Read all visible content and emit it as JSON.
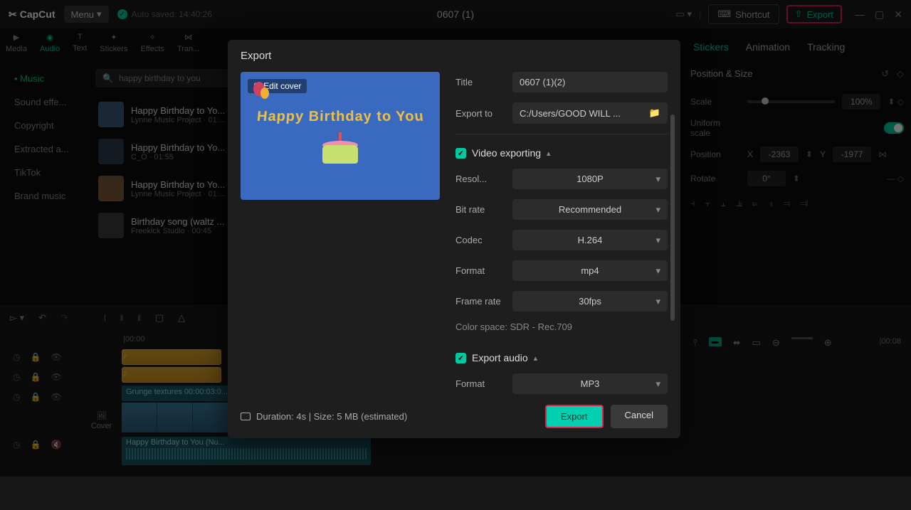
{
  "topbar": {
    "logo": "CapCut",
    "menu": "Menu",
    "autosave": "Auto saved: 14:40:26",
    "project": "0607 (1)",
    "shortcut": "Shortcut",
    "export": "Export"
  },
  "tabs": {
    "media": "Media",
    "audio": "Audio",
    "text": "Text",
    "stickers": "Stickers",
    "effects": "Effects",
    "trans": "Tran..."
  },
  "sidebar": [
    "Music",
    "Sound effe...",
    "Copyright",
    "Extracted a...",
    "TikTok",
    "Brand music"
  ],
  "search": "happy birthday to you",
  "tracks": [
    {
      "title": "Happy Birthday to Yo...",
      "meta": "Lynne Music Project · 01:..."
    },
    {
      "title": "Happy Birthday to Yo...",
      "meta": "C_O · 01:55"
    },
    {
      "title": "Happy Birthday to Yo...",
      "meta": "Lynne Music Project · 01:..."
    },
    {
      "title": "Birthday song (waltz ...",
      "meta": "Freekick Studio · 00:45"
    }
  ],
  "rightTabs": {
    "stickers": "Stickers",
    "animation": "Animation",
    "tracking": "Tracking"
  },
  "props": {
    "pos_size": "Position & Size",
    "scale": "Scale",
    "scale_val": "100%",
    "uniform": "Uniform scale",
    "position": "Position",
    "x": "X",
    "x_val": "-2363",
    "y": "Y",
    "y_val": "-1977",
    "rotate": "Rotate",
    "rotate_val": "0°"
  },
  "timeline": {
    "ruler0": "|00:00",
    "ruler1": "|00:08",
    "texture": "Grunge textures   00:00:03:0...",
    "hb_clip": "Happy Birthday to You (Nu...",
    "cover": "Cover"
  },
  "modal": {
    "title": "Export",
    "edit_cover": "Edit cover",
    "preview_text": "Happy Birthday to You",
    "fields": {
      "title_lbl": "Title",
      "title_val": "0607 (1)(2)",
      "export_to_lbl": "Export to",
      "export_to_val": "C:/Users/GOOD WILL ...",
      "video_exporting": "Video exporting",
      "resol_lbl": "Resol...",
      "resol_val": "1080P",
      "bitrate_lbl": "Bit rate",
      "bitrate_val": "Recommended",
      "codec_lbl": "Codec",
      "codec_val": "H.264",
      "format_lbl": "Format",
      "format_val": "mp4",
      "fps_lbl": "Frame rate",
      "fps_val": "30fps",
      "color_space": "Color space: SDR - Rec.709",
      "export_audio": "Export audio",
      "audio_format_lbl": "Format",
      "audio_format_val": "MP3"
    },
    "footer": {
      "duration": "Duration: 4s | Size: 5 MB (estimated)",
      "export": "Export",
      "cancel": "Cancel"
    }
  }
}
